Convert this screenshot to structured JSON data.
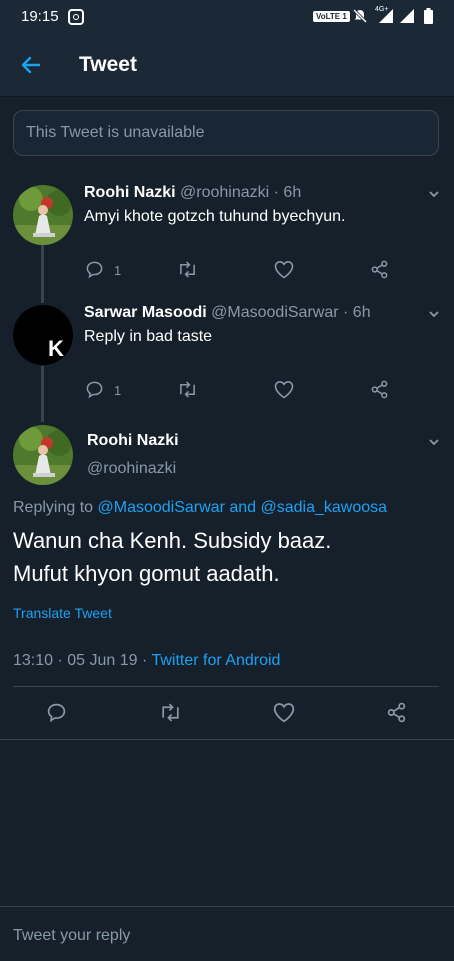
{
  "status_bar": {
    "time": "19:15",
    "volte": "VoLTE 1",
    "net": "4G+"
  },
  "header": {
    "title": "Tweet"
  },
  "unavailable": {
    "text": "This Tweet is unavailable"
  },
  "replies": [
    {
      "name": "Roohi Nazki",
      "handle": "@roohinazki",
      "time": "· 6h",
      "text": "Amyi khote gotzch tuhund byechyun.",
      "reply_count": "1"
    },
    {
      "name": "Sarwar Masoodi",
      "handle": "@MasoodiSarwar",
      "time": "· 6h",
      "text": "Reply in bad taste",
      "reply_count": "1",
      "avatar_letter": "K"
    }
  ],
  "main_tweet": {
    "name": "Roohi Nazki",
    "handle": "@roohinazki",
    "replying_prefix": "Replying to ",
    "replying_user1": "@MasoodiSarwar",
    "replying_and": " and ",
    "replying_user2": "@sadia_kawoosa",
    "text_line1": "Wanun cha Kenh. Subsidy baaz.",
    "text_line2": "Mufut khyon gomut aadath.",
    "translate": "Translate Tweet",
    "timestamp": "13:10 · 05 Jun 19 · ",
    "source": "Twitter for Android"
  },
  "reply_input": {
    "placeholder": "Tweet your reply"
  },
  "colors": {
    "background": "#15202b",
    "accent": "#1da1f2",
    "muted": "#8899a6"
  }
}
